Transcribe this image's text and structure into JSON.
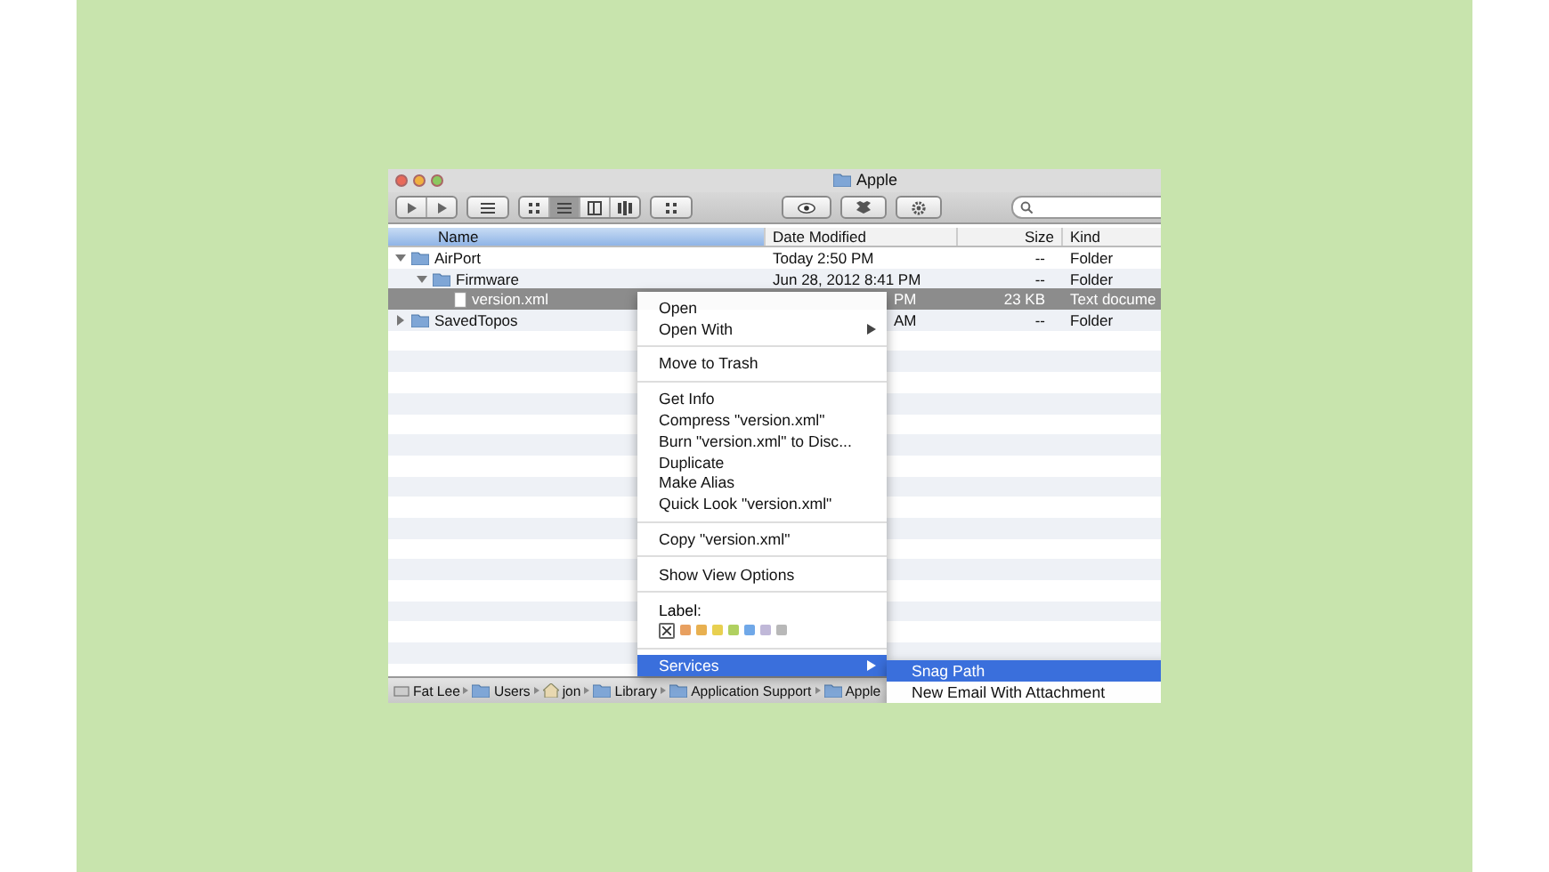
{
  "window": {
    "title": "Apple"
  },
  "toolbar": {
    "view_buttons": [
      {
        "kind": "icons",
        "selected": false
      },
      {
        "kind": "list",
        "selected": true
      },
      {
        "kind": "columns",
        "selected": false
      },
      {
        "kind": "coverflow",
        "selected": false
      }
    ]
  },
  "columns": [
    {
      "label": "Name",
      "selected": true
    },
    {
      "label": "Date Modified",
      "selected": false
    },
    {
      "label": "Size",
      "selected": false
    },
    {
      "label": "Kind",
      "selected": false
    }
  ],
  "rows": [
    {
      "name": "AirPort",
      "kind": "folder",
      "expanded": true,
      "selected": false,
      "date": "Today 2:50 PM",
      "date_covered": false,
      "size": "--",
      "type": "Folder",
      "children": [
        {
          "name": "Firmware",
          "kind": "folder",
          "expanded": true,
          "selected": false,
          "date": "Jun 28, 2012 8:41 PM",
          "date_covered": false,
          "size": "--",
          "type": "Folder",
          "children": [
            {
              "name": "version.xml",
              "kind": "file",
              "selected": true,
              "date": "PM",
              "date_covered": true,
              "size": "23 KB",
              "type": "Text docume"
            }
          ]
        }
      ]
    },
    {
      "name": "SavedTopos",
      "kind": "folder",
      "expanded": false,
      "selected": false,
      "date": "AM",
      "date_covered": true,
      "size": "--",
      "type": "Folder"
    }
  ],
  "path_bar": [
    {
      "label": "Fat Lee",
      "kind": "disk"
    },
    {
      "label": "Users",
      "kind": "folder"
    },
    {
      "label": "jon",
      "kind": "home"
    },
    {
      "label": "Library",
      "kind": "folder"
    },
    {
      "label": "Application Support",
      "kind": "folder"
    },
    {
      "label": "Apple",
      "kind": "folder"
    }
  ],
  "context_menu": {
    "sections": [
      [
        {
          "label": "Open",
          "submenu": false,
          "selected": false
        },
        {
          "label": "Open With",
          "submenu": true,
          "selected": false
        }
      ],
      [
        {
          "label": "Move to Trash",
          "submenu": false,
          "selected": false
        }
      ],
      [
        {
          "label": "Get Info",
          "submenu": false,
          "selected": false
        },
        {
          "label": "Compress \"version.xml\"",
          "submenu": false,
          "selected": false
        },
        {
          "label": "Burn \"version.xml\" to Disc...",
          "submenu": false,
          "selected": false
        },
        {
          "label": "Duplicate",
          "submenu": false,
          "selected": false
        },
        {
          "label": "Make Alias",
          "submenu": false,
          "selected": false
        },
        {
          "label": "Quick Look \"version.xml\"",
          "submenu": false,
          "selected": false
        }
      ],
      [
        {
          "label": "Copy \"version.xml\"",
          "submenu": false,
          "selected": false
        }
      ],
      [
        {
          "label": "Show View Options",
          "submenu": false,
          "selected": false
        }
      ]
    ],
    "label": {
      "title": "Label:",
      "colors": [
        {
          "kind": "none",
          "selected": false
        },
        {
          "kind": "color",
          "color": "#e8a060",
          "selected": false
        },
        {
          "kind": "color",
          "color": "#e8b050",
          "selected": false
        },
        {
          "kind": "color",
          "color": "#e8d050",
          "selected": false
        },
        {
          "kind": "color",
          "color": "#b0d060",
          "selected": false
        },
        {
          "kind": "color",
          "color": "#70a8e8",
          "selected": false
        },
        {
          "kind": "color",
          "color": "#c0b8d8",
          "selected": false
        },
        {
          "kind": "color",
          "color": "#b8b8b8",
          "selected": false
        }
      ]
    },
    "last": [
      {
        "label": "Services",
        "submenu": true,
        "selected": true
      }
    ]
  },
  "submenu": [
    {
      "label": "Snag Path",
      "selected": true
    },
    {
      "label": "New Email With Attachment",
      "selected": false
    }
  ]
}
